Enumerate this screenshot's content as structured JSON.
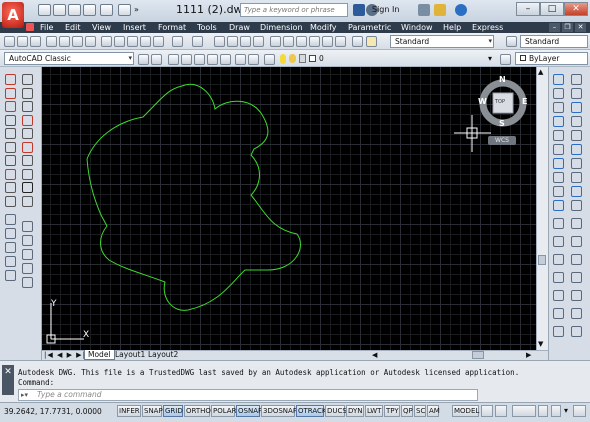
{
  "app": {
    "title": "1111 (2).dwg",
    "search_placeholder": "Type a keyword or phrase",
    "sign_in": "Sign In",
    "logo_letter": "A"
  },
  "menu": [
    "File",
    "Edit",
    "View",
    "Insert",
    "Format",
    "Tools",
    "Draw",
    "Dimension",
    "Modify",
    "Parametric",
    "Window",
    "Help",
    "Express"
  ],
  "toolbar": {
    "text_style": "Standard",
    "dim_style": "Standard",
    "workspace": "AutoCAD Classic",
    "layer": "0",
    "linetype": "ByLayer"
  },
  "viewcube": {
    "north": "N",
    "south": "S",
    "east": "E",
    "west": "W",
    "face": "TOP",
    "wcs": "WCS"
  },
  "ucs": {
    "x_label": "X",
    "y_label": "Y"
  },
  "layout_tabs": [
    "Model",
    "Layout1",
    "Layout2"
  ],
  "command": {
    "line1": "Autodesk DWG.  This file is a TrustedDWG last saved by an Autodesk application or Autodesk licensed application.",
    "line2": "Command:",
    "placeholder": "Type a command"
  },
  "status": {
    "coordinates": "39.2642, 17.7731, 0.0000",
    "toggles": [
      {
        "label": "INFER",
        "on": false
      },
      {
        "label": "SNAP",
        "on": false
      },
      {
        "label": "GRID",
        "on": true
      },
      {
        "label": "ORTHO",
        "on": false
      },
      {
        "label": "POLAR",
        "on": false
      },
      {
        "label": "OSNAP",
        "on": true
      },
      {
        "label": "3DOSNAP",
        "on": false
      },
      {
        "label": "OTRACK",
        "on": true
      },
      {
        "label": "DUCS",
        "on": false
      },
      {
        "label": "DYN",
        "on": false
      },
      {
        "label": "LWT",
        "on": false
      },
      {
        "label": "TPY",
        "on": false
      },
      {
        "label": "QP",
        "on": false
      },
      {
        "label": "SC",
        "on": false
      },
      {
        "label": "AM",
        "on": false
      }
    ],
    "model": "MODEL"
  },
  "colors": {
    "shape_stroke": "#3ddc2c",
    "drawing_bg": "#000000",
    "menu_bg": "#2e3b4a"
  }
}
